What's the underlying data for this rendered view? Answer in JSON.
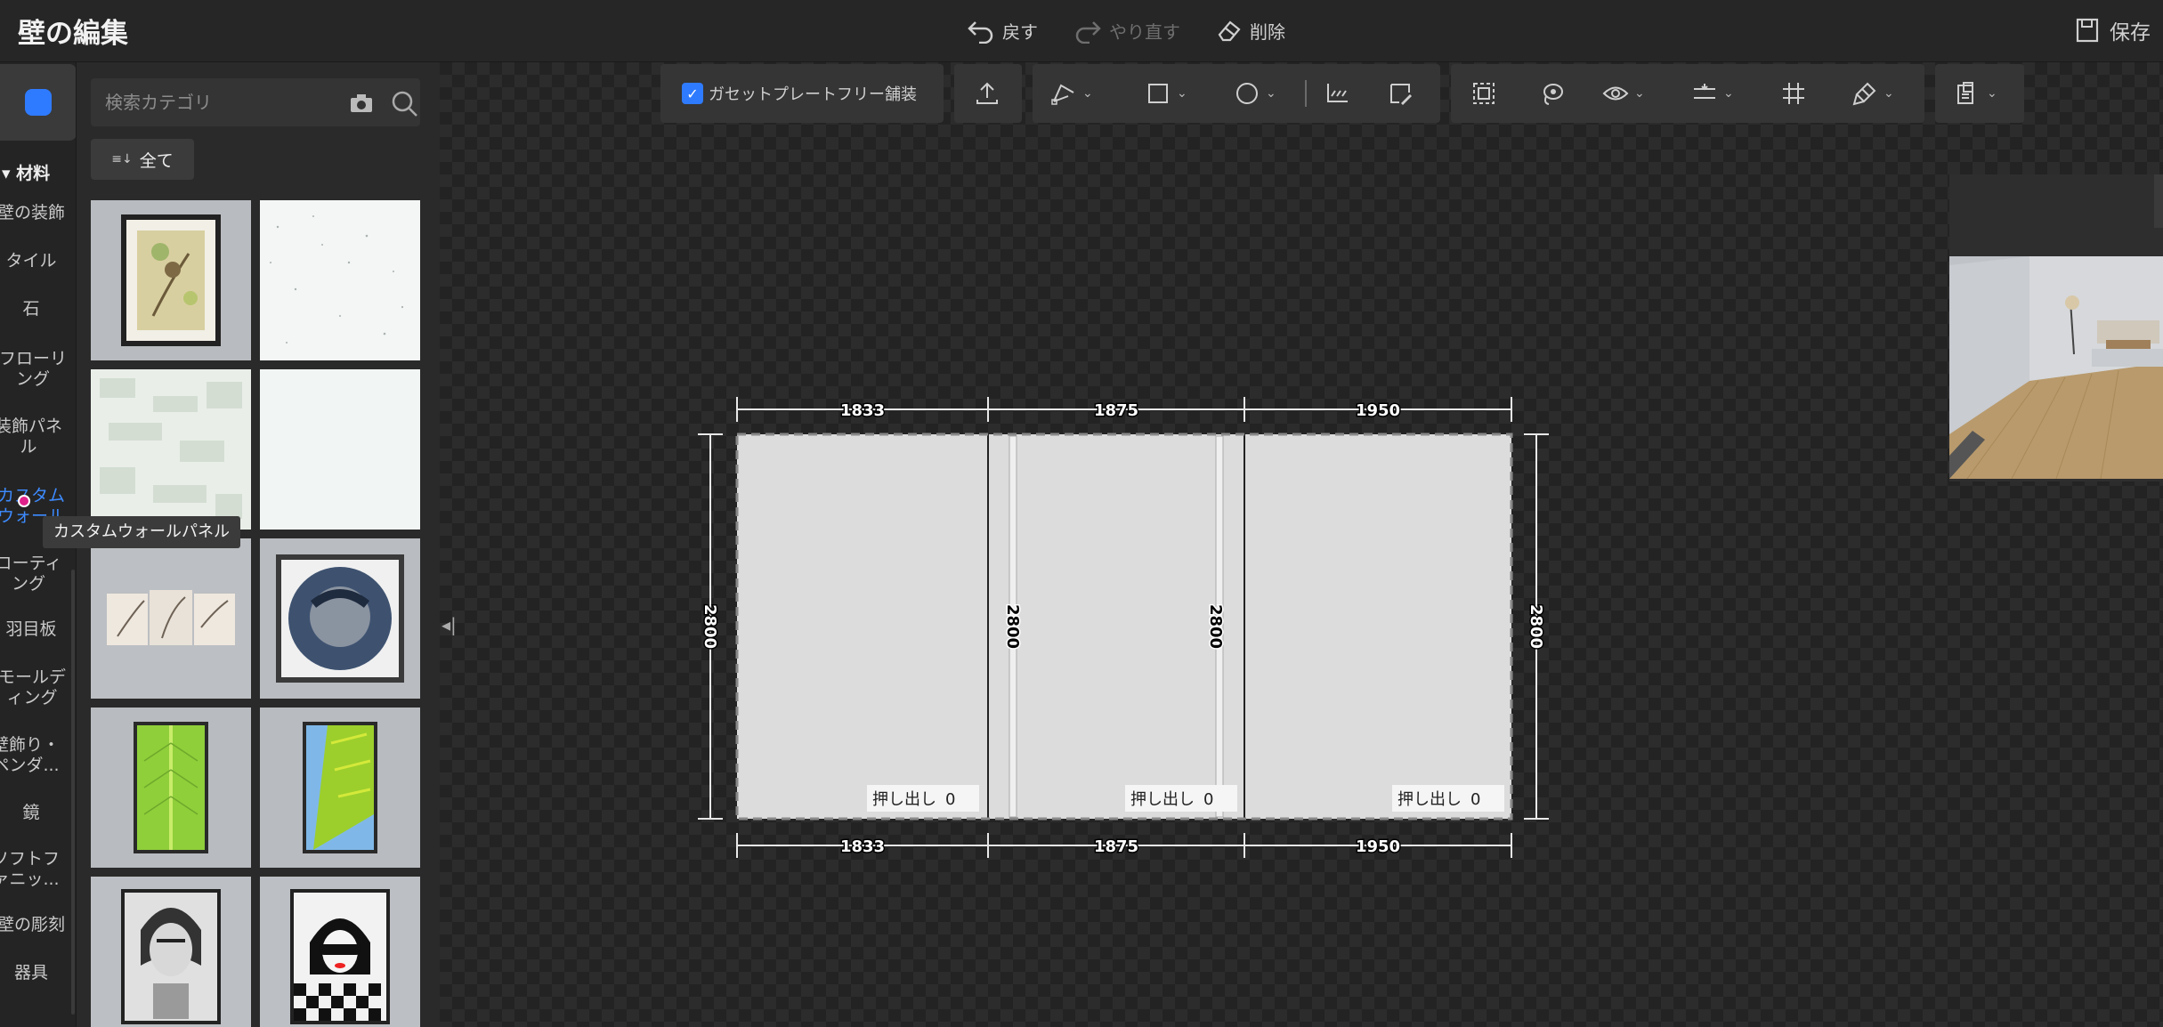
{
  "header": {
    "title": "壁の編集",
    "undo_label": "戻す",
    "redo_label": "やり直す",
    "delete_label": "削除",
    "save_label": "保存"
  },
  "rail": {
    "section": "▾ 材料",
    "items": [
      {
        "label": "壁の装飾"
      },
      {
        "label": "タイル"
      },
      {
        "label": "石"
      },
      {
        "label": "フローリング"
      },
      {
        "label": "装飾パネル"
      },
      {
        "label": "カスタムウォールパネル"
      },
      {
        "label": "コーティング"
      },
      {
        "label": "羽目板"
      },
      {
        "label": "モールディング"
      },
      {
        "label": "壁飾り・ペンダ..."
      },
      {
        "label": "鏡"
      },
      {
        "label": "ソフトファニッ..."
      },
      {
        "label": "壁の彫刻"
      },
      {
        "label": "器具"
      }
    ],
    "active_index": 5
  },
  "tooltip": "カスタムウォールパネル",
  "panel": {
    "search_placeholder": "検索カテゴリ",
    "filter_label": "全て",
    "tiles": [
      {
        "kind": "framed-bird-art"
      },
      {
        "kind": "speckled-white"
      },
      {
        "kind": "pale-camo"
      },
      {
        "kind": "plain-white"
      },
      {
        "kind": "triptych-stone"
      },
      {
        "kind": "round-portrait"
      },
      {
        "kind": "green-leaf"
      },
      {
        "kind": "banana-leaf"
      },
      {
        "kind": "frida-portrait"
      },
      {
        "kind": "checker-girl"
      }
    ]
  },
  "toolbar": {
    "gasset_label": "ガセットプレートフリー舗装",
    "gasset_checked": true,
    "icons": [
      "upload-icon",
      "pen-tool-icon",
      "rectangle-icon",
      "circle-icon",
      "align-baseline-icon",
      "edit-shape-icon",
      "select-area-icon",
      "lasso-icon",
      "eye-icon",
      "split-icon",
      "grid-icon",
      "paint-brush-icon",
      "layout-icon"
    ]
  },
  "wall": {
    "segments": [
      1833,
      1875,
      1950
    ],
    "height": 2800,
    "extrusion_label": "押し出し",
    "extrusion_values": [
      "0",
      "0",
      "0"
    ],
    "top_dims": [
      "1833",
      "1875",
      "1950"
    ],
    "bottom_dims": [
      "1833",
      "1875",
      "1950"
    ],
    "side_dims": [
      "2800",
      "2800",
      "2800",
      "2800"
    ]
  },
  "colors": {
    "accent": "#3d8bff",
    "panel_bg": "#2a2a2a",
    "wall_fill": "#dcdcdc"
  }
}
